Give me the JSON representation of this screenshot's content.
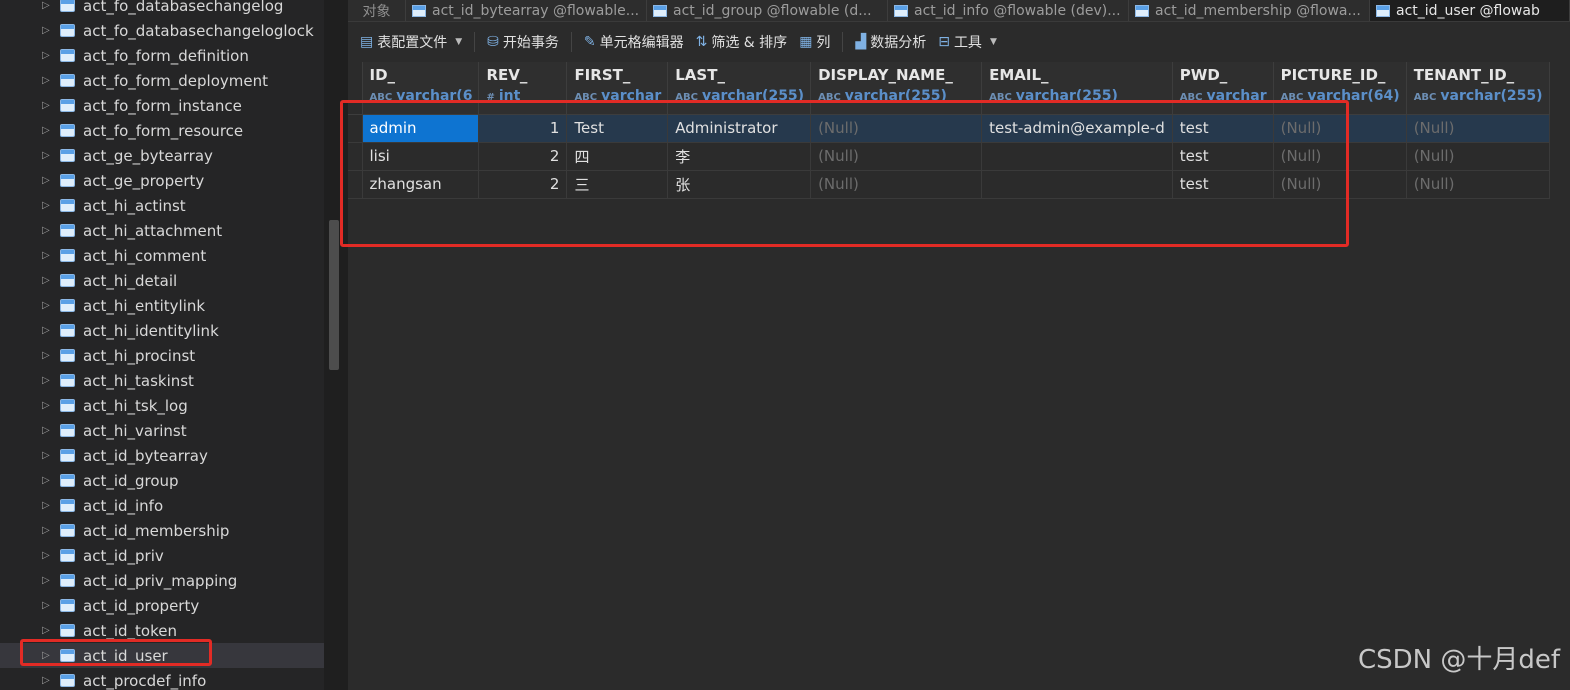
{
  "sidebar": {
    "items": [
      "act_fo_databasechangelog",
      "act_fo_databasechangeloglock",
      "act_fo_form_definition",
      "act_fo_form_deployment",
      "act_fo_form_instance",
      "act_fo_form_resource",
      "act_ge_bytearray",
      "act_ge_property",
      "act_hi_actinst",
      "act_hi_attachment",
      "act_hi_comment",
      "act_hi_detail",
      "act_hi_entitylink",
      "act_hi_identitylink",
      "act_hi_procinst",
      "act_hi_taskinst",
      "act_hi_tsk_log",
      "act_hi_varinst",
      "act_id_bytearray",
      "act_id_group",
      "act_id_info",
      "act_id_membership",
      "act_id_priv",
      "act_id_priv_mapping",
      "act_id_property",
      "act_id_token",
      "act_id_user",
      "act_procdef_info"
    ],
    "selected_item": "act_id_user"
  },
  "tabs": {
    "objects_label": "对象",
    "items": [
      {
        "label": "act_id_bytearray @flowable..."
      },
      {
        "label": "act_id_group @flowable (d..."
      },
      {
        "label": "act_id_info @flowable (dev)..."
      },
      {
        "label": "act_id_membership @flowa..."
      },
      {
        "label": "act_id_user @flowab"
      }
    ],
    "active_index": 4
  },
  "toolbar": {
    "config_file": "表配置文件",
    "begin_transaction": "开始事务",
    "cell_editor": "单元格编辑器",
    "filter_sort": "筛选 & 排序",
    "columns": "列",
    "data_analysis": "数据分析",
    "tools": "工具"
  },
  "grid": {
    "columns": [
      {
        "name": "ID_",
        "type": "varchar(6"
      },
      {
        "name": "REV_",
        "type": "int"
      },
      {
        "name": "FIRST_",
        "type": "varchar"
      },
      {
        "name": "LAST_",
        "type": "varchar(255)"
      },
      {
        "name": "DISPLAY_NAME_",
        "type": "varchar(255)"
      },
      {
        "name": "EMAIL_",
        "type": "varchar(255)"
      },
      {
        "name": "PWD_",
        "type": "varchar"
      },
      {
        "name": "PICTURE_ID_",
        "type": "varchar(64)"
      },
      {
        "name": "TENANT_ID_",
        "type": "varchar(255)"
      }
    ],
    "rows": [
      [
        "admin",
        "1",
        "Test",
        "Administrator",
        "(Null)",
        "test-admin@example-d",
        "test",
        "(Null)",
        "(Null)"
      ],
      [
        "lisi",
        "2",
        "四",
        "李",
        "(Null)",
        "",
        "test",
        "(Null)",
        "(Null)"
      ],
      [
        "zhangsan",
        "2",
        "三",
        "张",
        "(Null)",
        "",
        "test",
        "(Null)",
        "(Null)"
      ]
    ],
    "null_text": "(Null)"
  },
  "watermark": "CSDN @十月def"
}
